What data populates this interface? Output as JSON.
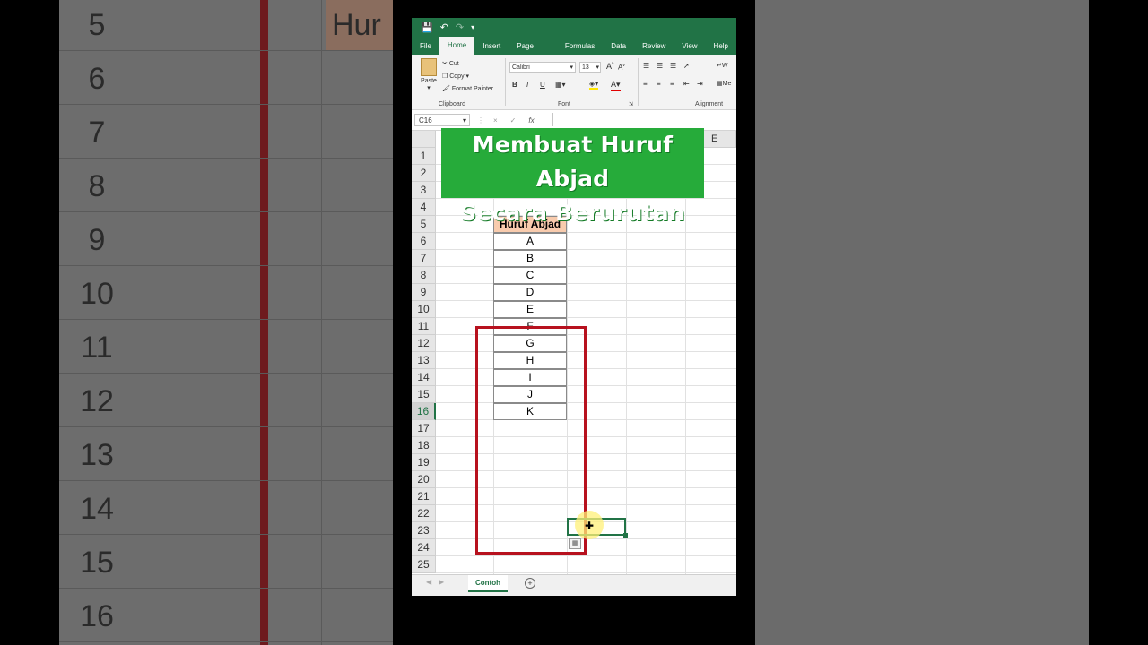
{
  "excel": {
    "tabs": [
      "File",
      "Home",
      "Insert",
      "Page Layout",
      "Formulas",
      "Data",
      "Review",
      "View",
      "Help"
    ],
    "active_tab": "Home",
    "clipboard": {
      "paste": "Paste",
      "cut": "Cut",
      "copy": "Copy",
      "format_painter": "Format Painter",
      "group": "Clipboard"
    },
    "font": {
      "name": "Calibri",
      "size": "13",
      "bold": "B",
      "italic": "I",
      "underline": "U",
      "group": "Font"
    },
    "alignment": {
      "group": "Alignment",
      "wrap": "W",
      "merge": "Me"
    },
    "name_box": "C16",
    "formula_cancel": "×",
    "formula_enter": "✓",
    "formula_fx": "fx",
    "column_e": "E",
    "banner": {
      "line1": "Membuat Huruf Abjad",
      "line2": "Secara Berurutan"
    },
    "table_header": "Huruf Abjad",
    "letters": [
      "A",
      "B",
      "C",
      "D",
      "E",
      "F",
      "G",
      "H",
      "I",
      "J",
      "K"
    ],
    "rows": [
      "1",
      "2",
      "3",
      "4",
      "5",
      "6",
      "7",
      "8",
      "9",
      "10",
      "11",
      "12",
      "13",
      "14",
      "15",
      "16",
      "17",
      "18",
      "19",
      "20",
      "21",
      "22",
      "23",
      "24",
      "25"
    ],
    "active_row": "16",
    "sheet_tab": "Contoh",
    "add_sheet": "+"
  },
  "background": {
    "rows": [
      "5",
      "6",
      "7",
      "8",
      "9",
      "10",
      "11",
      "12",
      "13",
      "14",
      "15",
      "16"
    ],
    "title_fragment": "Hur"
  }
}
